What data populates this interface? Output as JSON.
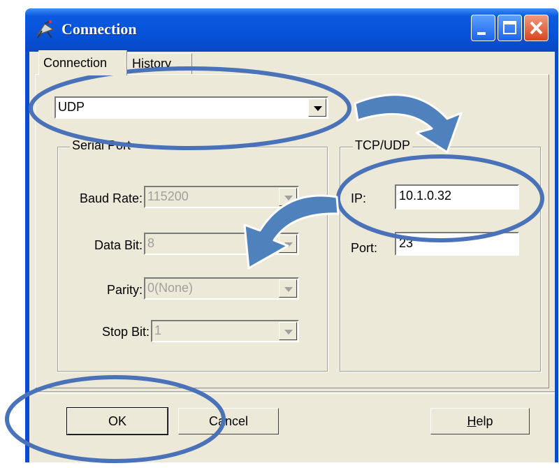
{
  "window": {
    "title": "Connection",
    "title_icon": "satellite-antenna-icon",
    "controls": [
      "minimize-icon",
      "maximize-icon",
      "close-icon"
    ]
  },
  "tabs": [
    {
      "label": "Connection",
      "active": true
    },
    {
      "label": "History",
      "active": false
    }
  ],
  "protocol": {
    "value": "UDP"
  },
  "serial_port": {
    "legend": "Serial Port",
    "baud_rate": {
      "label": "Baud Rate:",
      "value": "115200"
    },
    "data_bit": {
      "label": "Data Bit:",
      "value": "8"
    },
    "parity": {
      "label": "Parity:",
      "value": "0(None)"
    },
    "stop_bit": {
      "label": "Stop Bit:",
      "value": "1"
    }
  },
  "tcp_udp": {
    "legend": "TCP/UDP",
    "ip": {
      "label": "IP:",
      "value": "10.1.0.32"
    },
    "port": {
      "label": "Port:",
      "value": "23"
    }
  },
  "buttons": {
    "ok": "OK",
    "cancel": "Cancel",
    "help_mnemonic": "H",
    "help_rest": "elp"
  },
  "annotation_color": "#4a72b8",
  "annotation_fill": "#4f81bd"
}
